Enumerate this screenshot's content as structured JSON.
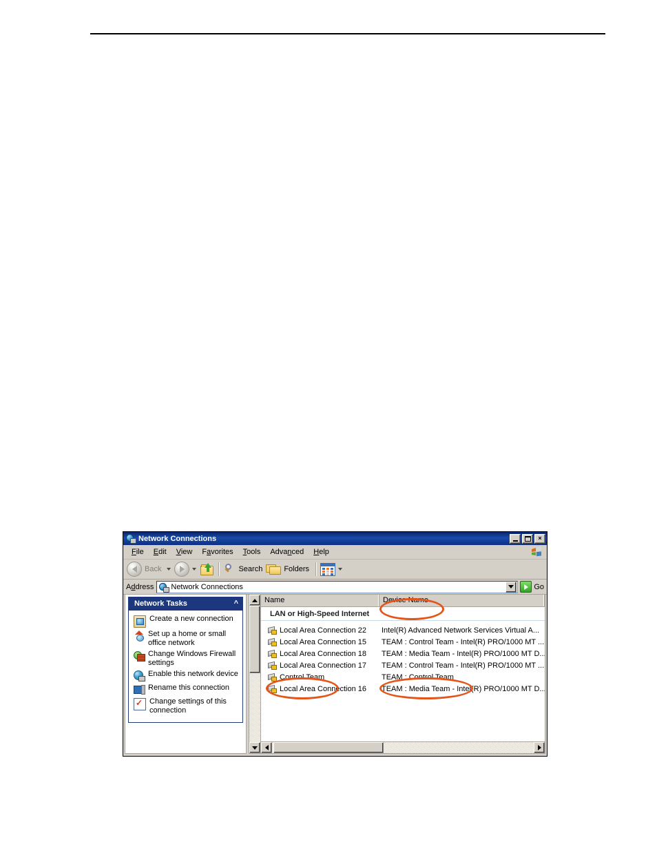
{
  "window": {
    "title": "Network Connections",
    "title_icon": "network-globe-icon",
    "buttons": {
      "minimize": "minimize-button",
      "maximize": "maximize-button",
      "close": "×"
    }
  },
  "menubar": {
    "items": [
      {
        "label": "File",
        "accel": "F"
      },
      {
        "label": "Edit",
        "accel": "E"
      },
      {
        "label": "View",
        "accel": "V"
      },
      {
        "label": "Favorites",
        "accel": "a"
      },
      {
        "label": "Tools",
        "accel": "T"
      },
      {
        "label": "Advanced",
        "accel": "n"
      },
      {
        "label": "Help",
        "accel": "H"
      }
    ]
  },
  "toolbar": {
    "back_label": "Back",
    "forward_label": "",
    "up_icon": "up-one-level-icon",
    "search_label": "Search",
    "folders_label": "Folders",
    "views_icon": "views-icon"
  },
  "address": {
    "label": "Address",
    "value": "Network Connections",
    "icon": "network-globe-icon",
    "go_label": "Go"
  },
  "sidebar": {
    "panel_title": "Network Tasks",
    "collapse_icon": "chevron-up-icon",
    "tasks": [
      {
        "label": "Create a new connection",
        "icon": "new-connection-icon"
      },
      {
        "label": "Set up a home or small office network",
        "icon": "home-network-icon"
      },
      {
        "label": "Change Windows Firewall settings",
        "icon": "firewall-icon"
      },
      {
        "label": "Enable this network device",
        "icon": "enable-device-icon"
      },
      {
        "label": "Rename this connection",
        "icon": "rename-icon"
      },
      {
        "label": "Change settings of this connection",
        "icon": "settings-icon"
      }
    ]
  },
  "list": {
    "columns": [
      {
        "key": "name",
        "label": "Name"
      },
      {
        "key": "device",
        "label": "Device Name"
      }
    ],
    "group_header": "LAN or High-Speed Internet",
    "rows": [
      {
        "name": "Local Area Connection 22",
        "device": "Intel(R) Advanced Network Services Virtual A..."
      },
      {
        "name": "Local Area Connection 15",
        "device": "TEAM : Control Team - Intel(R) PRO/1000 MT ..."
      },
      {
        "name": "Local Area Connection 18",
        "device": "TEAM : Media Team - Intel(R) PRO/1000 MT D..."
      },
      {
        "name": "Local Area Connection 17",
        "device": "TEAM : Control Team - Intel(R) PRO/1000 MT ..."
      },
      {
        "name": "Control Team",
        "device": "TEAM : Control Team"
      },
      {
        "name": "Local Area Connection 16",
        "device": "TEAM : Media Team - Intel(R) PRO/1000 MT D..."
      }
    ]
  },
  "annotations": {
    "color": "#e3551a",
    "highlights": [
      "Device Name column header",
      "Control Team connection name",
      "TEAM : Control Team device name"
    ]
  }
}
